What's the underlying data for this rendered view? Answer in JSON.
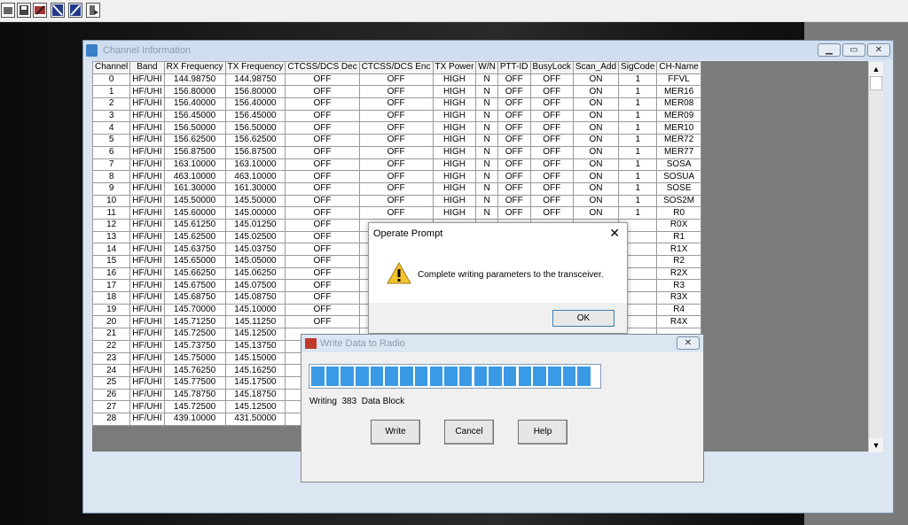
{
  "toolbar": {
    "icons": [
      "open-file-icon",
      "save-icon",
      "edit-icon",
      "read-radio-icon",
      "write-radio-icon",
      "exit-icon"
    ]
  },
  "channel_window": {
    "title": "Channel Information",
    "columns": [
      "Channel",
      "Band",
      "RX Frequency",
      "TX Frequency",
      "CTCSS/DCS Dec",
      "CTCSS/DCS Enc",
      "TX Power",
      "W/N",
      "PTT-ID",
      "BusyLock",
      "Scan_Add",
      "SigCode",
      "CH-Name"
    ],
    "rows": [
      [
        "0",
        "HF/UHI",
        "144.98750",
        "144.98750",
        "OFF",
        "OFF",
        "HIGH",
        "N",
        "OFF",
        "OFF",
        "ON",
        "1",
        "FFVL"
      ],
      [
        "1",
        "HF/UHI",
        "156.80000",
        "156.80000",
        "OFF",
        "OFF",
        "HIGH",
        "N",
        "OFF",
        "OFF",
        "ON",
        "1",
        "MER16"
      ],
      [
        "2",
        "HF/UHI",
        "156.40000",
        "156.40000",
        "OFF",
        "OFF",
        "HIGH",
        "N",
        "OFF",
        "OFF",
        "ON",
        "1",
        "MER08"
      ],
      [
        "3",
        "HF/UHI",
        "156.45000",
        "156.45000",
        "OFF",
        "OFF",
        "HIGH",
        "N",
        "OFF",
        "OFF",
        "ON",
        "1",
        "MER09"
      ],
      [
        "4",
        "HF/UHI",
        "156.50000",
        "156.50000",
        "OFF",
        "OFF",
        "HIGH",
        "N",
        "OFF",
        "OFF",
        "ON",
        "1",
        "MER10"
      ],
      [
        "5",
        "HF/UHI",
        "156.62500",
        "156.62500",
        "OFF",
        "OFF",
        "HIGH",
        "N",
        "OFF",
        "OFF",
        "ON",
        "1",
        "MER72"
      ],
      [
        "6",
        "HF/UHI",
        "156.87500",
        "156.87500",
        "OFF",
        "OFF",
        "HIGH",
        "N",
        "OFF",
        "OFF",
        "ON",
        "1",
        "MER77"
      ],
      [
        "7",
        "HF/UHI",
        "163.10000",
        "163.10000",
        "OFF",
        "OFF",
        "HIGH",
        "N",
        "OFF",
        "OFF",
        "ON",
        "1",
        "SOSA"
      ],
      [
        "8",
        "HF/UHI",
        "463.10000",
        "463.10000",
        "OFF",
        "OFF",
        "HIGH",
        "N",
        "OFF",
        "OFF",
        "ON",
        "1",
        "SOSUA"
      ],
      [
        "9",
        "HF/UHI",
        "161.30000",
        "161.30000",
        "OFF",
        "OFF",
        "HIGH",
        "N",
        "OFF",
        "OFF",
        "ON",
        "1",
        "SOSE"
      ],
      [
        "10",
        "HF/UHI",
        "145.50000",
        "145.50000",
        "OFF",
        "OFF",
        "HIGH",
        "N",
        "OFF",
        "OFF",
        "ON",
        "1",
        "SOS2M"
      ],
      [
        "11",
        "HF/UHI",
        "145.60000",
        "145.00000",
        "OFF",
        "OFF",
        "HIGH",
        "N",
        "OFF",
        "OFF",
        "ON",
        "1",
        "R0"
      ],
      [
        "12",
        "HF/UHI",
        "145.61250",
        "145.01250",
        "OFF",
        "",
        "",
        "",
        "",
        "",
        "",
        "",
        "R0X"
      ],
      [
        "13",
        "HF/UHI",
        "145.62500",
        "145.02500",
        "OFF",
        "",
        "",
        "",
        "",
        "",
        "",
        "",
        "R1"
      ],
      [
        "14",
        "HF/UHI",
        "145.63750",
        "145.03750",
        "OFF",
        "",
        "",
        "",
        "",
        "",
        "",
        "",
        "R1X"
      ],
      [
        "15",
        "HF/UHI",
        "145.65000",
        "145.05000",
        "OFF",
        "",
        "",
        "",
        "",
        "",
        "",
        "",
        "R2"
      ],
      [
        "16",
        "HF/UHI",
        "145.66250",
        "145.06250",
        "OFF",
        "",
        "",
        "",
        "",
        "",
        "",
        "",
        "R2X"
      ],
      [
        "17",
        "HF/UHI",
        "145.67500",
        "145.07500",
        "OFF",
        "",
        "",
        "",
        "",
        "",
        "",
        "",
        "R3"
      ],
      [
        "18",
        "HF/UHI",
        "145.68750",
        "145.08750",
        "OFF",
        "",
        "",
        "",
        "",
        "",
        "",
        "",
        "R3X"
      ],
      [
        "19",
        "HF/UHI",
        "145.70000",
        "145.10000",
        "OFF",
        "",
        "",
        "",
        "",
        "",
        "",
        "",
        "R4"
      ],
      [
        "20",
        "HF/UHI",
        "145.71250",
        "145.11250",
        "OFF",
        "",
        "",
        "",
        "",
        "",
        "",
        "",
        "R4X"
      ],
      [
        "21",
        "HF/UHI",
        "145.72500",
        "145.12500",
        "",
        "",
        "",
        "",
        "",
        "",
        "",
        "",
        ""
      ],
      [
        "22",
        "HF/UHI",
        "145.73750",
        "145.13750",
        "",
        "",
        "",
        "",
        "",
        "",
        "",
        "",
        ""
      ],
      [
        "23",
        "HF/UHI",
        "145.75000",
        "145.15000",
        "",
        "",
        "",
        "",
        "",
        "",
        "",
        "",
        ""
      ],
      [
        "24",
        "HF/UHI",
        "145.76250",
        "145.16250",
        "",
        "",
        "",
        "",
        "",
        "",
        "",
        "",
        ""
      ],
      [
        "25",
        "HF/UHI",
        "145.77500",
        "145.17500",
        "",
        "",
        "",
        "",
        "",
        "",
        "",
        "",
        ""
      ],
      [
        "26",
        "HF/UHI",
        "145.78750",
        "145.18750",
        "",
        "",
        "",
        "",
        "",
        "",
        "",
        "",
        ""
      ],
      [
        "27",
        "HF/UHI",
        "145.72500",
        "145.12500",
        "",
        "",
        "",
        "",
        "",
        "",
        "",
        "",
        ""
      ],
      [
        "28",
        "HF/UHI",
        "439.10000",
        "431.50000",
        "",
        "",
        "",
        "",
        "",
        "",
        "",
        "",
        ""
      ]
    ]
  },
  "operate_prompt": {
    "title": "Operate Prompt",
    "close_glyph": "✕",
    "message": "Complete writing parameters to the transceiver.",
    "ok_label": "OK"
  },
  "write_dialog": {
    "title": "Write Data to Radio",
    "progress_fraction": 1.0,
    "status_prefix": "Writing",
    "block_number": "383",
    "status_suffix": "Data Block",
    "write_label": "Write",
    "cancel_label": "Cancel",
    "help_label": "Help"
  },
  "colors": {
    "progress": "#3b9ae6",
    "desktop": "#1e1e1e"
  }
}
